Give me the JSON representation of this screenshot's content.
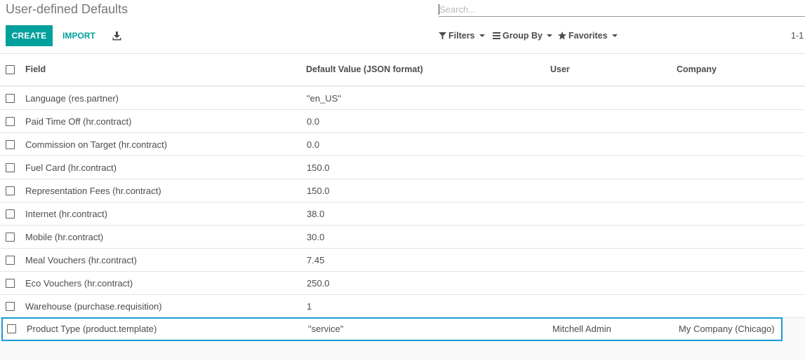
{
  "breadcrumb": "User-defined Defaults",
  "search": {
    "placeholder": "Search..."
  },
  "toolbar": {
    "create_label": "CREATE",
    "import_label": "IMPORT"
  },
  "filters": {
    "filters_label": "Filters",
    "group_by_label": "Group By",
    "favorites_label": "Favorites"
  },
  "pager": "1-1",
  "table": {
    "headers": {
      "field": "Field",
      "default_value": "Default Value (JSON format)",
      "user": "User",
      "company": "Company"
    },
    "rows": [
      {
        "field": "Language (res.partner)",
        "value": "\"en_US\"",
        "user": "",
        "company": ""
      },
      {
        "field": "Paid Time Off (hr.contract)",
        "value": "0.0",
        "user": "",
        "company": ""
      },
      {
        "field": "Commission on Target (hr.contract)",
        "value": "0.0",
        "user": "",
        "company": ""
      },
      {
        "field": "Fuel Card (hr.contract)",
        "value": "150.0",
        "user": "",
        "company": ""
      },
      {
        "field": "Representation Fees (hr.contract)",
        "value": "150.0",
        "user": "",
        "company": ""
      },
      {
        "field": "Internet (hr.contract)",
        "value": "38.0",
        "user": "",
        "company": ""
      },
      {
        "field": "Mobile (hr.contract)",
        "value": "30.0",
        "user": "",
        "company": ""
      },
      {
        "field": "Meal Vouchers (hr.contract)",
        "value": "7.45",
        "user": "",
        "company": ""
      },
      {
        "field": "Eco Vouchers (hr.contract)",
        "value": "250.0",
        "user": "",
        "company": ""
      },
      {
        "field": "Warehouse (purchase.requisition)",
        "value": "1",
        "user": "",
        "company": ""
      },
      {
        "field": "Product Type (product.template)",
        "value": "\"service\"",
        "user": "Mitchell Admin",
        "company": "My Company (Chicago)"
      }
    ]
  },
  "colors": {
    "accent": "#00a09d",
    "highlight_border": "#1a9ad6"
  }
}
